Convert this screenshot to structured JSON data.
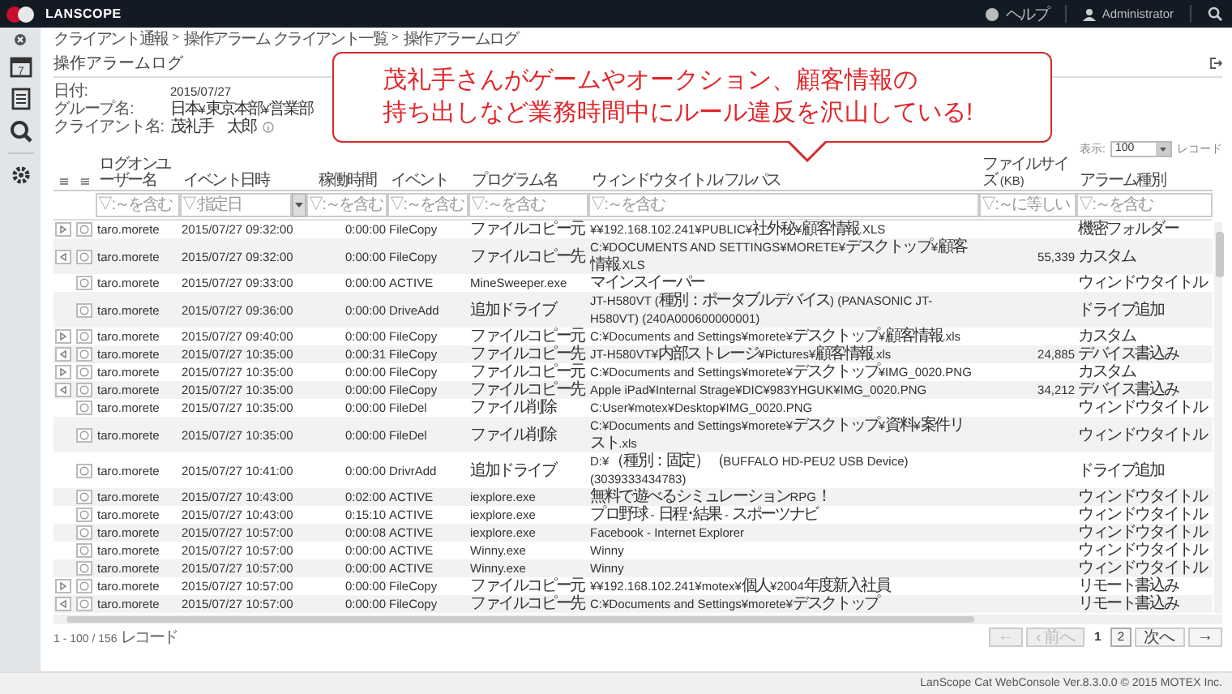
{
  "topbar": {
    "logo": "LANSCOPE",
    "help": "ヘルプ",
    "user": "Administrator"
  },
  "sidebar": {
    "calendar_day": "7"
  },
  "breadcrumb": {
    "items": [
      "クライアント通報",
      "操作アラーム クライアント一覧",
      "操作アラームログ"
    ],
    "separators": [
      ">",
      ">"
    ]
  },
  "page_title": "操作アラームログ",
  "info": [
    {
      "label": "日付:",
      "value": "2015/07/27"
    },
    {
      "label": "グループ名:",
      "value": "日本¥東京本部¥営業部"
    },
    {
      "label": "クライアント名:",
      "value": "茂礼手　太郎"
    }
  ],
  "callout": [
    "茂礼手さんがゲームやオークション、顧客情報の",
    "持ち出しなど業務時間中にルール違反を沢山している!"
  ],
  "page_size": {
    "label": "表示:",
    "value": "100",
    "unit": "レコード"
  },
  "table": {
    "columns": [
      {
        "label": "ログオンユーザー名",
        "placeholder": "▽:～を含む",
        "kind": "text"
      },
      {
        "label": "イベント日時",
        "placeholder": "▽:指定日",
        "kind": "date"
      },
      {
        "label": "稼働時間",
        "placeholder": "▽:～を含む",
        "kind": "number"
      },
      {
        "label": "イベント",
        "placeholder": "▽:～を含む",
        "kind": "text"
      },
      {
        "label": "プログラム名",
        "placeholder": "▽:～を含む",
        "kind": "text"
      },
      {
        "label": "ウィンドウタイトル/フルパス",
        "placeholder": "▽:～を含む",
        "kind": "text"
      },
      {
        "label": "ファイルサイズ (KB)",
        "placeholder": "▽:～に等しい",
        "kind": "number"
      },
      {
        "label": "アラーム種別",
        "placeholder": "▽:～を含む",
        "kind": "text"
      }
    ],
    "rows": [
      {
        "kind": "copy_source",
        "user": "taro.morete",
        "time": "2015/07/27 09:32:00",
        "duration": "0:00:00",
        "event": "FileCopy",
        "program": "ファイルコピー元",
        "path": "¥¥192.168.102.241¥PUBLIC¥社外秘¥顧客情報.XLS",
        "alarm": "機密フォルダー"
      },
      {
        "kind": "copy_target",
        "user": "taro.morete",
        "time": "2015/07/27 09:32:00",
        "duration": "0:00:00",
        "event": "FileCopy",
        "program": "ファイルコピー先",
        "path": "C:¥DOCUMENTS AND SETTINGS¥MORETE¥デスクトップ¥顧客情報.XLS",
        "size": "55,339",
        "alarm": "カスタム"
      },
      {
        "kind": "plain",
        "user": "taro.morete",
        "time": "2015/07/27 09:33:00",
        "duration": "0:00:00",
        "event": "ACTIVE",
        "program": "MineSweeper.exe",
        "path": "マインスイーパー",
        "alarm": "ウィンドウタイトル"
      },
      {
        "kind": "plain",
        "user": "taro.morete",
        "time": "2015/07/27 09:36:00",
        "duration": "0:00:00",
        "event": "DriveAdd",
        "program": "追加ドライブ",
        "path": "JT-H580VT (種別：ポータブルデバイス) (PANASONIC JT-H580VT) (240A000600000001)",
        "alarm": "ドライブ追加"
      },
      {
        "kind": "copy_source",
        "user": "taro.morete",
        "time": "2015/07/27 09:40:00",
        "duration": "0:00:00",
        "event": "FileCopy",
        "program": "ファイルコピー元",
        "path": "C:¥Documents and Settings¥morete¥デスクトップ¥顧客情報.xls",
        "alarm": "カスタム"
      },
      {
        "kind": "copy_target",
        "user": "taro.morete",
        "time": "2015/07/27 10:35:00",
        "duration": "0:00:31",
        "event": "FileCopy",
        "program": "ファイルコピー先",
        "path": "JT-H580VT¥内部ストレージ¥Pictures¥顧客情報.xls",
        "size": "24,885",
        "alarm": "デバイス書込み"
      },
      {
        "kind": "copy_source",
        "user": "taro.morete",
        "time": "2015/07/27 10:35:00",
        "duration": "0:00:00",
        "event": "FileCopy",
        "program": "ファイルコピー元",
        "path": "C:¥Documents and Settings¥morete¥デスクトップ¥IMG_0020.PNG",
        "alarm": "カスタム"
      },
      {
        "kind": "copy_target",
        "user": "taro.morete",
        "time": "2015/07/27 10:35:00",
        "duration": "0:00:00",
        "event": "FileCopy",
        "program": "ファイルコピー先",
        "path": "Apple iPad¥Internal Strage¥DIC¥983YHGUK¥IMG_0020.PNG",
        "size": "34,212",
        "alarm": "デバイス書込み"
      },
      {
        "kind": "plain",
        "user": "taro.morete",
        "time": "2015/07/27 10:35:00",
        "duration": "0:00:00",
        "event": "FileDel",
        "program": "ファイル削除",
        "path": "C:User¥motex¥Desktop¥IMG_0020.PNG",
        "alarm": "ウィンドウタイトル"
      },
      {
        "kind": "plain",
        "user": "taro.morete",
        "time": "2015/07/27 10:35:00",
        "duration": "0:00:00",
        "event": "FileDel",
        "program": "ファイル削除",
        "path": "C:¥Documents and Settings¥morete¥デスクトップ¥資料¥案件リスト.xls",
        "alarm": "ウィンドウタイトル"
      },
      {
        "kind": "plain",
        "user": "taro.morete",
        "time": "2015/07/27 10:41:00",
        "duration": "0:00:00",
        "event": "DrivrAdd",
        "program": "追加ドライブ",
        "path": "D:¥（種別：固定）（BUFFALO HD-PEU2 USB Device)(3039333434783)",
        "alarm": "ドライブ追加"
      },
      {
        "kind": "plain",
        "user": "taro.morete",
        "time": "2015/07/27 10:43:00",
        "duration": "0:02:00",
        "event": "ACTIVE",
        "program": "iexplore.exe",
        "path": "無料で遊べるシミュレーションRPG！",
        "alarm": "ウィンドウタイトル"
      },
      {
        "kind": "plain",
        "user": "taro.morete",
        "time": "2015/07/27 10:43:00",
        "duration": "0:15:10",
        "event": "ACTIVE",
        "program": "iexplore.exe",
        "path": "プロ野球 - 日程･結果 - スポーツナビ",
        "alarm": "ウィンドウタイトル"
      },
      {
        "kind": "plain",
        "user": "taro.morete",
        "time": "2015/07/27 10:57:00",
        "duration": "0:00:08",
        "event": "ACTIVE",
        "program": "iexplore.exe",
        "path": "Facebook - Internet Explorer",
        "alarm": "ウィンドウタイトル"
      },
      {
        "kind": "plain",
        "user": "taro.morete",
        "time": "2015/07/27 10:57:00",
        "duration": "0:00:00",
        "event": "ACTIVE",
        "program": "Winny.exe",
        "path": "Winny",
        "alarm": "ウィンドウタイトル"
      },
      {
        "kind": "plain",
        "user": "taro.morete",
        "time": "2015/07/27 10:57:00",
        "duration": "0:00:00",
        "event": "ACTIVE",
        "program": "Winny.exe",
        "path": "Winny",
        "alarm": "ウィンドウタイトル"
      },
      {
        "kind": "copy_source",
        "user": "taro.morete",
        "time": "2015/07/27 10:57:00",
        "duration": "0:00:00",
        "event": "FileCopy",
        "program": "ファイルコピー元",
        "path": "¥¥192.168.102.241¥motex¥個人¥2004年度新入社員",
        "alarm": "リモート書込み"
      },
      {
        "kind": "copy_target",
        "user": "taro.morete",
        "time": "2015/07/27 10:57:00",
        "duration": "0:00:00",
        "event": "FileCopy",
        "program": "ファイルコピー先",
        "path": "C:¥Documents and Settings¥morete¥デスクトップ",
        "alarm": "リモート書込み"
      }
    ]
  },
  "pager": {
    "summary": "1 - 100 / 156 レコード",
    "nav_prev": [
      {
        "label": "←",
        "disabled": true
      },
      {
        "label": "‹ 前へ",
        "disabled": true
      }
    ],
    "pages": [
      {
        "label": "1",
        "selected": true
      },
      {
        "label": "2",
        "selected": false
      }
    ],
    "nav_next": [
      {
        "label": "次へ",
        "disabled": false
      },
      {
        "label": "→",
        "disabled": false
      }
    ]
  },
  "footer": "LanScope Cat WebConsole Ver.8.3.0.0 © 2015 MOTEX Inc."
}
